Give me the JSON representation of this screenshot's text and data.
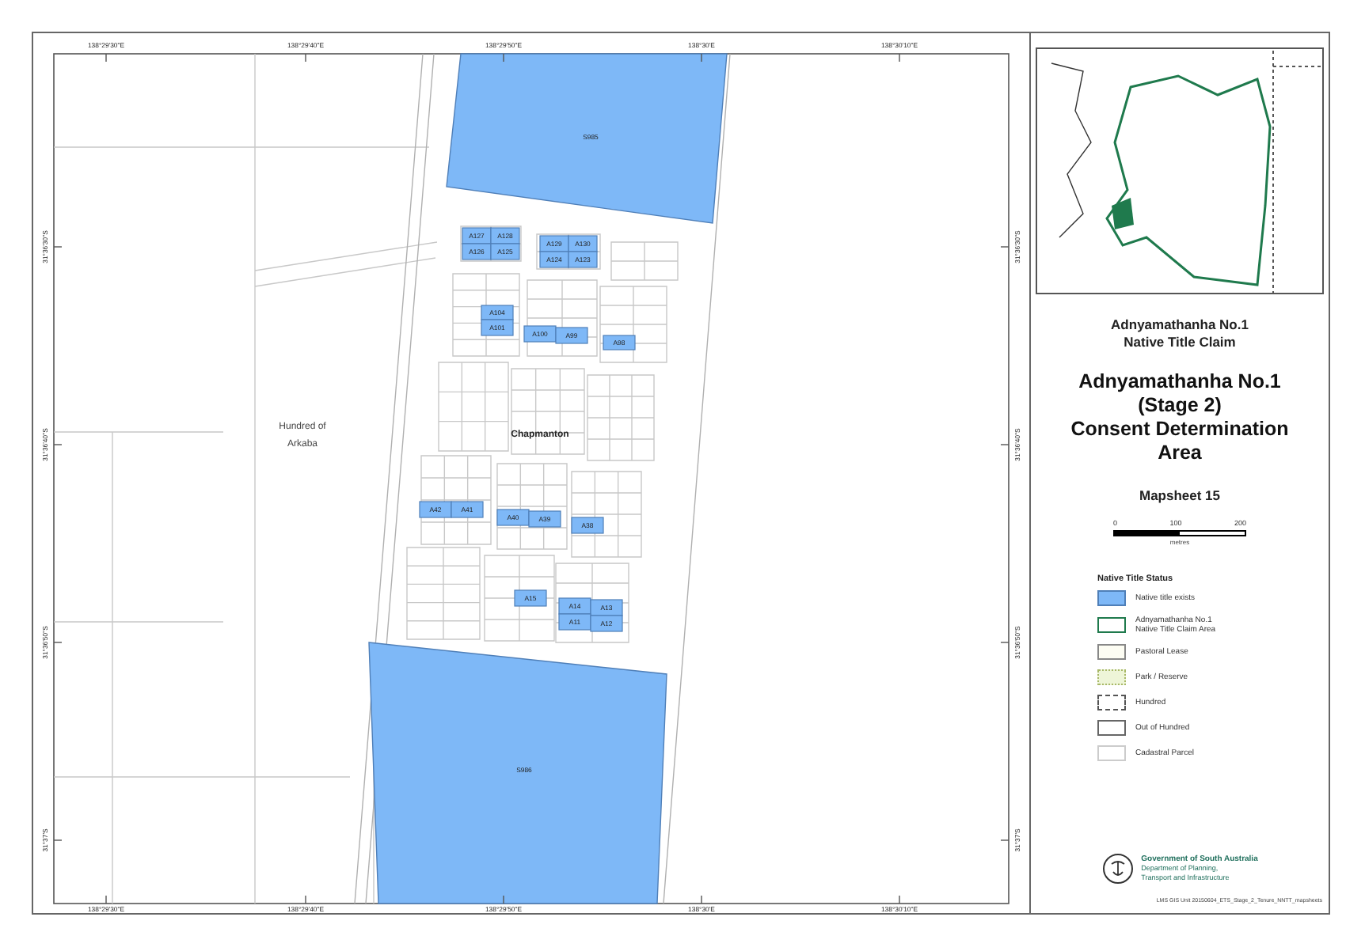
{
  "map": {
    "coordinates": {
      "top": [
        "138°29'30\"E",
        "138°29'40\"E",
        "138°29'50\"E",
        "138°30'E",
        "138°30'10\"E"
      ],
      "bottom": [
        "138°29'30\"E",
        "138°29'40\"E",
        "138°29'50\"E",
        "138°30'E",
        "138°30'10\"E"
      ],
      "left": [
        "31°36'30\"S",
        "31°36'40\"S",
        "31°36'50\"S",
        "31°37'S"
      ],
      "right": [
        "31°36'30\"S",
        "31°36'40\"S",
        "31°36'50\"S",
        "31°37'S"
      ]
    },
    "hundred_label": [
      "Hundred of",
      "Arkaba"
    ],
    "town_label": "Chapmanton",
    "sections": [
      {
        "label": "S985"
      },
      {
        "label": "S986"
      }
    ],
    "parcels": [
      {
        "label": "A127"
      },
      {
        "label": "A128"
      },
      {
        "label": "A126"
      },
      {
        "label": "A125"
      },
      {
        "label": "A129"
      },
      {
        "label": "A130"
      },
      {
        "label": "A124"
      },
      {
        "label": "A123"
      },
      {
        "label": "A104"
      },
      {
        "label": "A101"
      },
      {
        "label": "A100"
      },
      {
        "label": "A99"
      },
      {
        "label": "A98"
      },
      {
        "label": "A42"
      },
      {
        "label": "A41"
      },
      {
        "label": "A40"
      },
      {
        "label": "A39"
      },
      {
        "label": "A38"
      },
      {
        "label": "A15"
      },
      {
        "label": "A14"
      },
      {
        "label": "A13"
      },
      {
        "label": "A11"
      },
      {
        "label": "A12"
      }
    ]
  },
  "title_block": {
    "claim": [
      "Adnyamathanha No.1",
      "Native Title Claim"
    ],
    "title": [
      "Adnyamathanha No.1",
      "(Stage 2)",
      "Consent Determination",
      "Area"
    ],
    "mapsheet": "Mapsheet 15"
  },
  "scale_bar": {
    "ticks": [
      "0",
      "100",
      "200"
    ],
    "unit": "metres"
  },
  "legend": {
    "heading": "Native Title Status",
    "items": [
      {
        "kind": "native",
        "label": [
          "Native title exists"
        ]
      },
      {
        "kind": "claim",
        "label": [
          "Adnyamathanha No.1",
          "Native Title Claim Area"
        ]
      },
      {
        "kind": "pastoral",
        "label": [
          "Pastoral Lease"
        ]
      },
      {
        "kind": "park",
        "label": [
          "Park / Reserve"
        ]
      },
      {
        "kind": "hundred",
        "label": [
          "Hundred"
        ]
      },
      {
        "kind": "out",
        "label": [
          "Out of Hundred"
        ]
      },
      {
        "kind": "cadastral",
        "label": [
          "Cadastral Parcel"
        ]
      }
    ]
  },
  "footer": {
    "agency": "Government of South Australia",
    "department": [
      "Department of Planning,",
      "Transport and Infrastructure"
    ],
    "file_ref": "LMS GIS Unit 20150604_ETS_Stage_2_Tenure_NNTT_mapsheets"
  }
}
